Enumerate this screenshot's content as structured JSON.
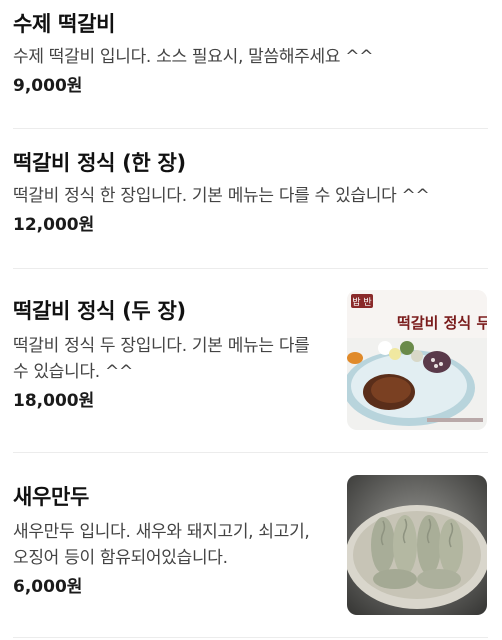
{
  "menu": {
    "items": [
      {
        "name": "수제 떡갈비",
        "description": "수제 떡갈비 입니다. 소스 필요시, 말씀해주세요 ^^",
        "price": "9,000원"
      },
      {
        "name": "떡갈비 정식 (한 장)",
        "description": "떡갈비 정식 한 장입니다. 기본 메뉴는 다를 수 있습니다 ^^",
        "price": "12,000원"
      },
      {
        "name": "떡갈비 정식 (두 장)",
        "description": "떡갈비 정식 두 장입니다. 기본 메뉴는 다를 수 있습니다. ^^",
        "price": "18,000원",
        "image": {
          "icon": "galbi-set-photo",
          "banner_text": "떡갈비 정식 두",
          "corner_text": "밥 반"
        }
      },
      {
        "name": "새우만두",
        "description": "새우만두 입니다. 새우와 돼지고기, 쇠고기, 오징어 등이 함유되어있습니다.",
        "price": "6,000원",
        "image": {
          "icon": "dumpling-photo"
        }
      }
    ]
  }
}
